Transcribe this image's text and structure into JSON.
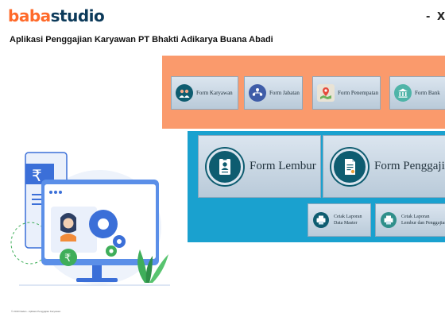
{
  "app": {
    "logo_part1": "baba",
    "logo_part2": "studio",
    "title": "Aplikasi Penggajian Karyawan PT Bhakti Adikarya Buana Abadi",
    "minimize": "-",
    "close": "X"
  },
  "top_buttons": [
    {
      "label": "Form Karyawan",
      "icon": "employees-icon"
    },
    {
      "label": "Form Jabatan",
      "icon": "organization-icon"
    },
    {
      "label": "Form Penempatan",
      "icon": "map-pin-icon"
    },
    {
      "label": "Form Bank",
      "icon": "bank-icon"
    }
  ],
  "main_buttons": [
    {
      "label": "Form Lembur",
      "icon": "id-badge-icon"
    },
    {
      "label": "Form Penggajian",
      "icon": "payroll-document-icon"
    }
  ],
  "report_buttons": [
    {
      "label": "Cetak Laporan\nData Master",
      "icon": "printer-icon"
    },
    {
      "label": "Cetak Laporan\nLembur dan Penggajian",
      "icon": "printer-icon"
    }
  ],
  "footer": "© 2019 Dadan - Aplikasi Penggajian Karyawan",
  "colors": {
    "orange_panel": "#fa9a6c",
    "blue_panel": "#1aa1cf",
    "logo_orange": "#ff6a2a",
    "logo_navy": "#0c3a5a",
    "icon_teal": "#0e5c70"
  }
}
